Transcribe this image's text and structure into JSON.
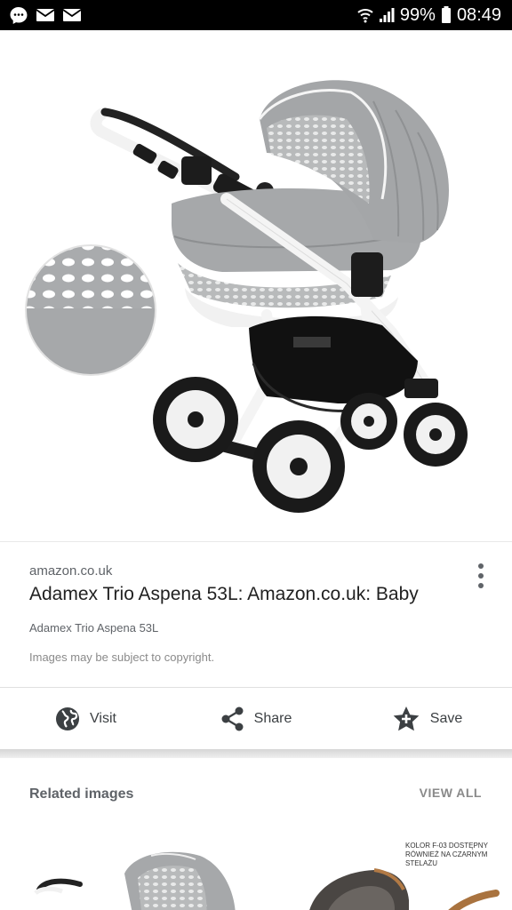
{
  "status_bar": {
    "battery": "99%",
    "time": "08:49"
  },
  "result": {
    "source": "amazon.co.uk",
    "title": "Adamex Trio Aspena 53L: Amazon.co.uk: Baby",
    "subtitle": "Adamex Trio Aspena 53L",
    "copyright_note": "Images may be subject to copyright."
  },
  "actions": {
    "visit_label": "Visit",
    "share_label": "Share",
    "save_label": "Save"
  },
  "related": {
    "heading": "Related images",
    "view_all_label": "VIEW ALL",
    "thumb2_caption": "KOLOR F-03 DOSTĘPNY RÓWNIEŻ NA CZARNYM STELAŻU"
  },
  "colors": {
    "status_bar_bg": "#000000",
    "fabric_grey": "#a7a9ab",
    "frame_white": "#f4f4f4",
    "tyre_black": "#1d1d1d"
  },
  "icons": {
    "status_left": [
      "messenger-icon",
      "mail-icon",
      "mail-icon"
    ],
    "status_right": [
      "wifi-icon",
      "signal-icon",
      "battery-icon"
    ],
    "actions": [
      "globe-icon",
      "share-icon",
      "star-add-icon"
    ],
    "more": "more-vert-icon"
  }
}
